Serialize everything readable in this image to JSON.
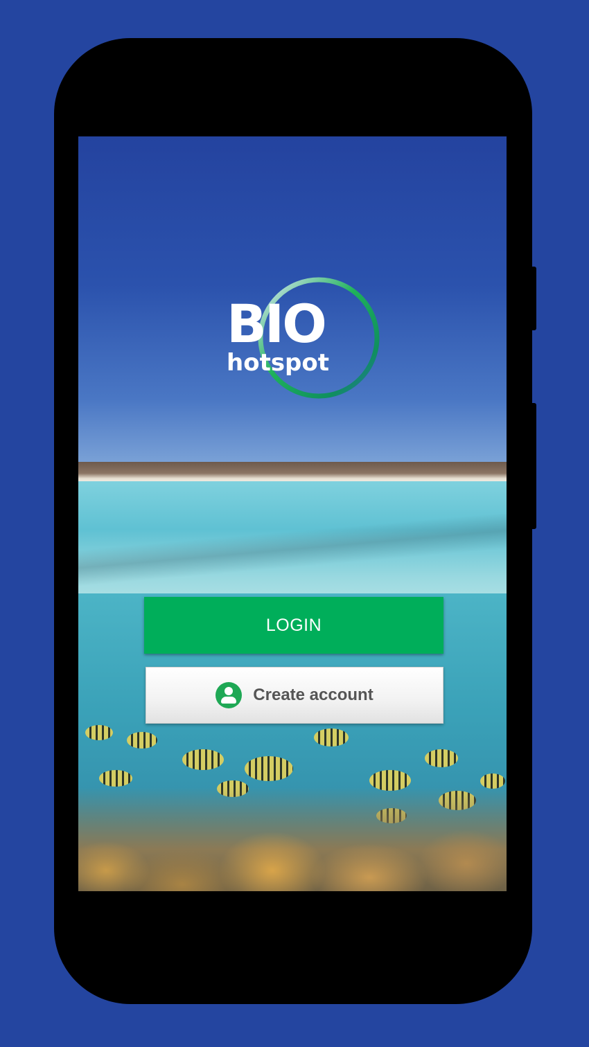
{
  "app": {
    "logo_bio": "BIO",
    "logo_hotspot": "hotspot"
  },
  "actions": {
    "login_label": "LOGIN",
    "create_account_label": "Create account",
    "create_account_icon": "account-circle-icon"
  },
  "colors": {
    "background": "#2445a0",
    "login_button": "#00ae5a",
    "account_icon": "#1fa855",
    "create_text": "#555555"
  }
}
